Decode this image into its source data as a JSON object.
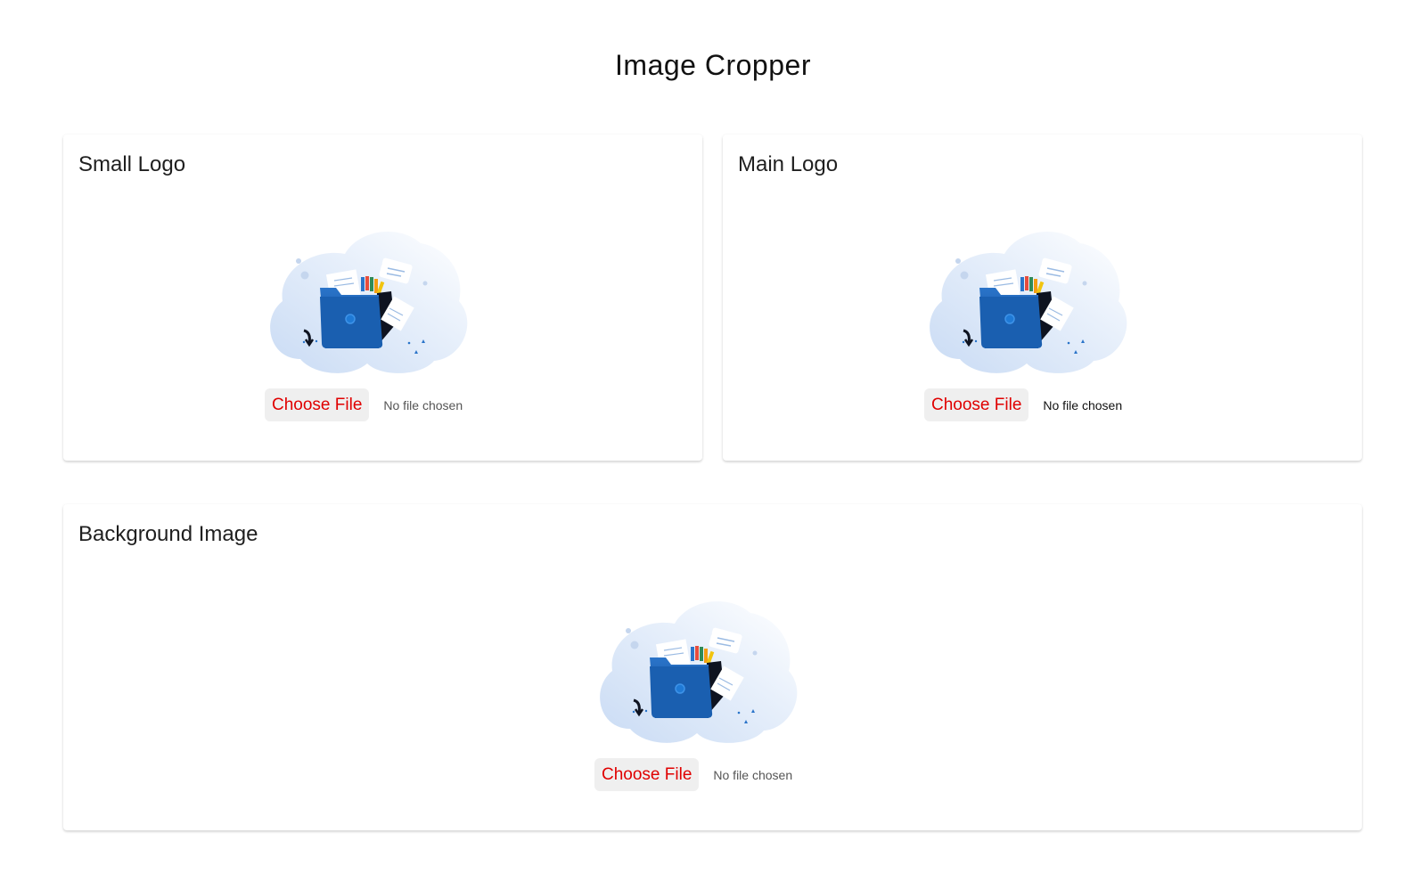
{
  "page": {
    "title": "Image Cropper"
  },
  "colors": {
    "button_text": "#e00000",
    "button_bg": "#efefef",
    "folder_blue": "#1f63b5",
    "cloud_blue": "#dce8f8"
  },
  "sections": [
    {
      "title": "Small Logo",
      "illustration_icon": "folder-upload-illustration",
      "choose_label": "Choose File",
      "status": "No file chosen"
    },
    {
      "title": "Main Logo",
      "illustration_icon": "folder-upload-illustration",
      "choose_label": "Choose File",
      "status": "No file chosen"
    },
    {
      "title": "Background Image",
      "illustration_icon": "folder-upload-illustration",
      "choose_label": "Choose File",
      "status": "No file chosen"
    }
  ]
}
